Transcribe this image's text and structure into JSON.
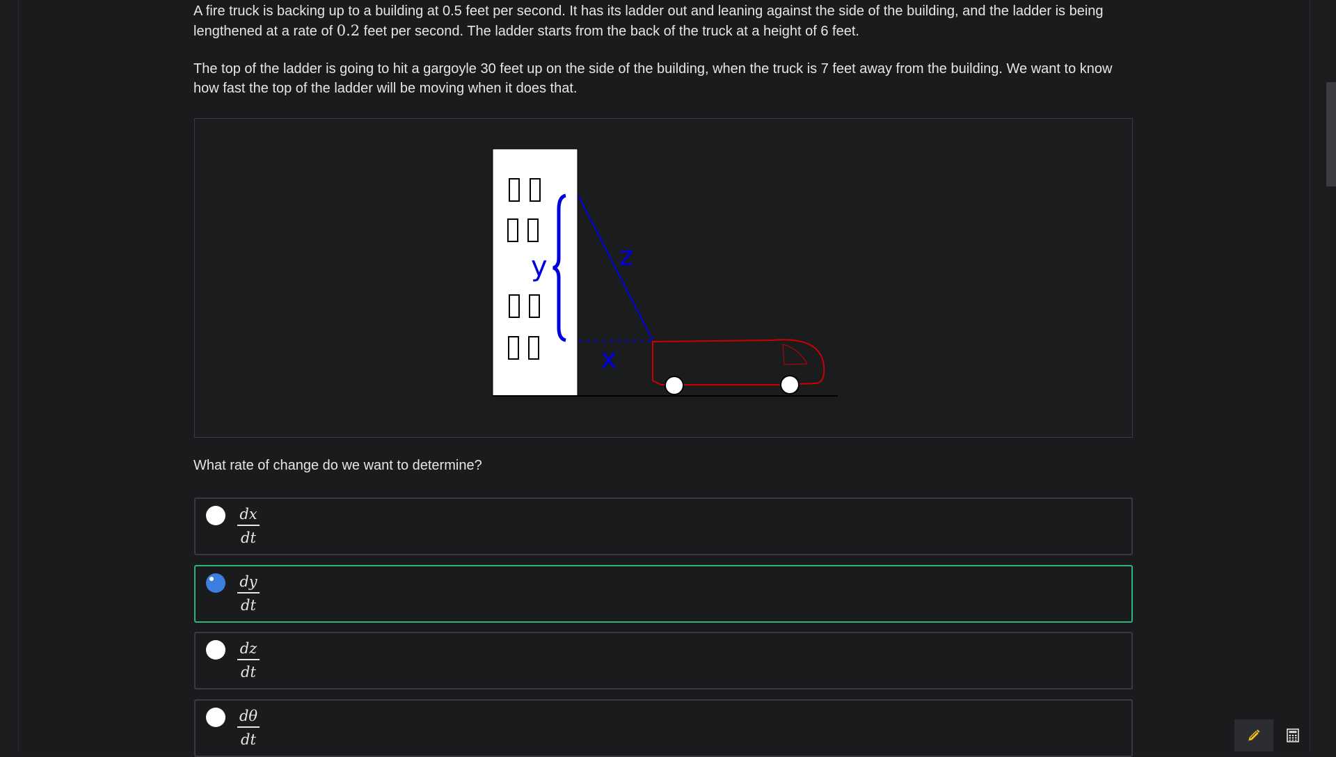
{
  "problem": {
    "p1_a": "A fire truck is backing up to a building at 0.5 feet per second. It has its ladder out and leaning against the side of the building, and the ladder is being lengthened at a rate of ",
    "p1_rate": "0.2",
    "p1_b": " feet per second. The ladder starts from the back of the truck at a height of 6 feet.",
    "p2": "The top of the ladder is going to hit a gargoyle 30 feet up on the side of the building, when the truck is 7 feet away from the building. We want to know how fast the top of the ladder will be moving when it does that."
  },
  "figure": {
    "label_y": "y",
    "label_z": "z",
    "label_x": "x",
    "colors": {
      "building": "#ffffff",
      "labels": "#0000dd",
      "truck": "#cc0000",
      "ground": "#000000"
    }
  },
  "question": "What rate of change do we want to determine?",
  "options": [
    {
      "num": "dx",
      "den": "dt",
      "selected": false
    },
    {
      "num": "dy",
      "den": "dt",
      "selected": true
    },
    {
      "num": "dz",
      "den": "dt",
      "selected": false
    },
    {
      "num": "dθ",
      "den": "dt",
      "selected": false
    }
  ],
  "toolbar": {
    "pencil_icon": "pencil-icon",
    "calculator_icon": "calculator-icon",
    "accent": "#f0c020"
  }
}
